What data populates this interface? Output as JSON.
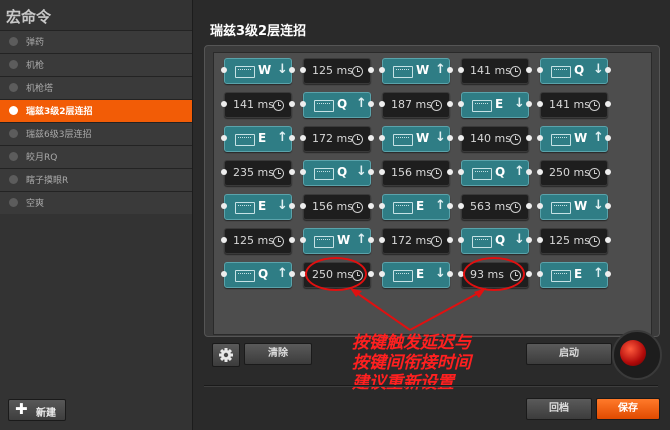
{
  "panel": {
    "title": "宏命令"
  },
  "macros": [
    {
      "label": "弹药",
      "selected": false
    },
    {
      "label": "机枪",
      "selected": false
    },
    {
      "label": "机枪塔",
      "selected": false
    },
    {
      "label": "瑞兹3级2层连招",
      "selected": true
    },
    {
      "label": "瑞兹6级3层连招",
      "selected": false
    },
    {
      "label": "皎月RQ",
      "selected": false
    },
    {
      "label": "瞎子摸眼R",
      "selected": false
    },
    {
      "label": "空爽",
      "selected": false
    }
  ],
  "new_button": "新建",
  "macro_title": "瑞兹3级2层连招",
  "sequence": [
    [
      {
        "t": "key",
        "k": "W",
        "d": "down"
      },
      {
        "t": "delay",
        "v": "125ms"
      },
      {
        "t": "key",
        "k": "W",
        "d": "up"
      },
      {
        "t": "delay",
        "v": "141ms"
      },
      {
        "t": "key",
        "k": "Q",
        "d": "down"
      }
    ],
    [
      {
        "t": "delay",
        "v": "141ms"
      },
      {
        "t": "key",
        "k": "Q",
        "d": "up"
      },
      {
        "t": "delay",
        "v": "187ms"
      },
      {
        "t": "key",
        "k": "E",
        "d": "down"
      },
      {
        "t": "delay",
        "v": "141ms"
      }
    ],
    [
      {
        "t": "key",
        "k": "E",
        "d": "up"
      },
      {
        "t": "delay",
        "v": "172ms"
      },
      {
        "t": "key",
        "k": "W",
        "d": "down"
      },
      {
        "t": "delay",
        "v": "140ms"
      },
      {
        "t": "key",
        "k": "W",
        "d": "up"
      }
    ],
    [
      {
        "t": "delay",
        "v": "235ms"
      },
      {
        "t": "key",
        "k": "Q",
        "d": "down"
      },
      {
        "t": "delay",
        "v": "156ms"
      },
      {
        "t": "key",
        "k": "Q",
        "d": "up"
      },
      {
        "t": "delay",
        "v": "250ms"
      }
    ],
    [
      {
        "t": "key",
        "k": "E",
        "d": "down"
      },
      {
        "t": "delay",
        "v": "156ms"
      },
      {
        "t": "key",
        "k": "E",
        "d": "up"
      },
      {
        "t": "delay",
        "v": "563ms"
      },
      {
        "t": "key",
        "k": "W",
        "d": "down"
      }
    ],
    [
      {
        "t": "delay",
        "v": "125ms"
      },
      {
        "t": "key",
        "k": "W",
        "d": "up"
      },
      {
        "t": "delay",
        "v": "172ms"
      },
      {
        "t": "key",
        "k": "Q",
        "d": "down"
      },
      {
        "t": "delay",
        "v": "125ms"
      }
    ],
    [
      {
        "t": "key",
        "k": "Q",
        "d": "up"
      },
      {
        "t": "delay",
        "v": "250ms",
        "hl": true
      },
      {
        "t": "key",
        "k": "E",
        "d": "down"
      },
      {
        "t": "delay",
        "v": "93ms",
        "hl": true
      },
      {
        "t": "key",
        "k": "E",
        "d": "up"
      }
    ]
  ],
  "buttons": {
    "clear": "清除",
    "start": "启动",
    "revert": "回档",
    "save": "保存"
  },
  "annotation": [
    "按键触发延迟与",
    "按键间衔接时间",
    "建议重新设置"
  ],
  "colors": {
    "accent": "#f25c06",
    "key_block": "#2f7d85",
    "annotation": "#ff2020"
  }
}
